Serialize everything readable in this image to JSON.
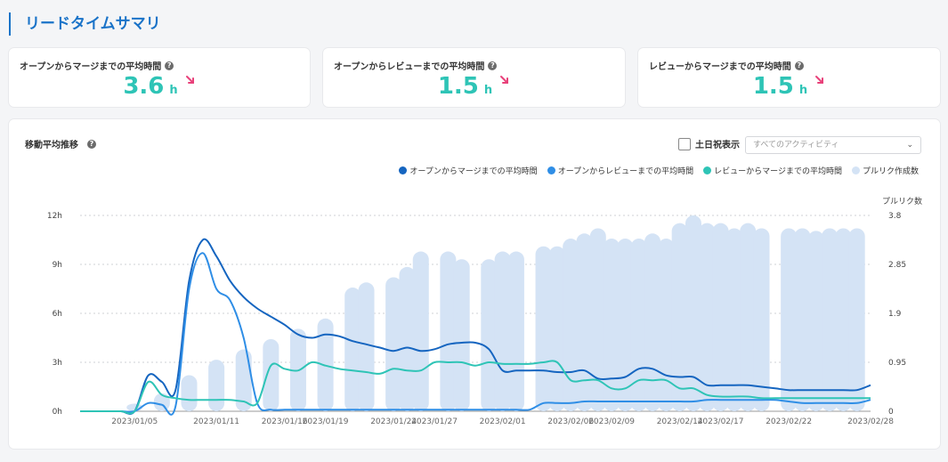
{
  "header": {
    "title": "リードタイムサマリ"
  },
  "stats": [
    {
      "label": "オープンからマージまでの平均時間",
      "value": "3.6",
      "unit": "h",
      "trend": "down"
    },
    {
      "label": "オープンからレビューまでの平均時間",
      "value": "1.5",
      "unit": "h",
      "trend": "down"
    },
    {
      "label": "レビューからマージまでの平均時間",
      "value": "1.5",
      "unit": "h",
      "trend": "down"
    }
  ],
  "help_glyph": "?",
  "chart_panel": {
    "title": "移動平均推移",
    "holiday_label": "土日祝表示",
    "holiday_checked": false,
    "activity_placeholder": "すべてのアクティビティ",
    "chevron": "⌄"
  },
  "colors": {
    "accent": "#1a73c8",
    "value": "#2ec4b6",
    "trend_down": "#e8417a",
    "series_open_merge": "#1565c0",
    "series_open_review": "#2f8ee6",
    "series_review_merge": "#2ec4b6",
    "series_pr_count": "#d4e3f5"
  },
  "chart_data": {
    "type": "bar+line",
    "x": [
      "2023/01/01",
      "2023/01/02",
      "2023/01/03",
      "2023/01/04",
      "2023/01/05",
      "2023/01/06",
      "2023/01/07",
      "2023/01/08",
      "2023/01/09",
      "2023/01/10",
      "2023/01/11",
      "2023/01/12",
      "2023/01/13",
      "2023/01/14",
      "2023/01/15",
      "2023/01/16",
      "2023/01/17",
      "2023/01/18",
      "2023/01/19",
      "2023/01/20",
      "2023/01/21",
      "2023/01/22",
      "2023/01/23",
      "2023/01/24",
      "2023/01/25",
      "2023/01/26",
      "2023/01/27",
      "2023/01/28",
      "2023/01/29",
      "2023/01/30",
      "2023/01/31",
      "2023/02/01",
      "2023/02/02",
      "2023/02/03",
      "2023/02/04",
      "2023/02/05",
      "2023/02/06",
      "2023/02/07",
      "2023/02/08",
      "2023/02/09",
      "2023/02/10",
      "2023/02/11",
      "2023/02/12",
      "2023/02/13",
      "2023/02/14",
      "2023/02/15",
      "2023/02/16",
      "2023/02/17",
      "2023/02/18",
      "2023/02/19",
      "2023/02/20",
      "2023/02/21",
      "2023/02/22",
      "2023/02/23",
      "2023/02/24",
      "2023/02/25",
      "2023/02/26",
      "2023/02/27",
      "2023/02/28"
    ],
    "x_ticks": [
      "2023/01/05",
      "2023/01/11",
      "2023/01/16",
      "2023/01/19",
      "2023/01/24",
      "2023/01/27",
      "2023/02/01",
      "2023/02/06",
      "2023/02/09",
      "2023/02/14",
      "2023/02/17",
      "2023/02/22",
      "2023/02/28"
    ],
    "y_left": {
      "ticks": [
        "0h",
        "3h",
        "6h",
        "9h",
        "12h"
      ],
      "range": [
        0,
        12
      ]
    },
    "y_right": {
      "label": "プルリク数",
      "ticks": [
        "0",
        "0.95",
        "1.9",
        "2.85",
        "3.8"
      ],
      "range": [
        0,
        3.8
      ]
    },
    "bar_days": [
      "2023/01/05",
      "2023/01/07",
      "2023/01/09",
      "2023/01/11",
      "2023/01/13",
      "2023/01/15",
      "2023/01/17",
      "2023/01/19",
      "2023/01/21",
      "2023/01/22",
      "2023/01/24",
      "2023/01/25",
      "2023/01/26",
      "2023/01/28",
      "2023/01/29",
      "2023/01/31",
      "2023/02/01",
      "2023/02/02",
      "2023/02/04",
      "2023/02/05",
      "2023/02/06",
      "2023/02/07",
      "2023/02/08",
      "2023/02/09",
      "2023/02/10",
      "2023/02/11",
      "2023/02/12",
      "2023/02/13",
      "2023/02/14",
      "2023/02/15",
      "2023/02/16",
      "2023/02/17",
      "2023/02/18",
      "2023/02/19",
      "2023/02/20",
      "2023/02/22",
      "2023/02/23",
      "2023/02/24",
      "2023/02/25",
      "2023/02/26",
      "2023/02/27"
    ],
    "bars": {
      "name": "プルリク作成数",
      "values": [
        0.15,
        0.35,
        0.7,
        1.0,
        1.2,
        1.4,
        1.6,
        1.8,
        2.4,
        2.5,
        2.6,
        2.8,
        3.1,
        3.1,
        2.95,
        2.95,
        3.1,
        3.1,
        3.2,
        3.2,
        3.35,
        3.45,
        3.55,
        3.35,
        3.35,
        3.35,
        3.45,
        3.35,
        3.65,
        3.8,
        3.65,
        3.65,
        3.55,
        3.65,
        3.55,
        3.55,
        3.55,
        3.5,
        3.55,
        3.55,
        3.55
      ]
    },
    "series": [
      {
        "name": "オープンからマージまでの平均時間",
        "values": [
          0,
          0,
          0,
          0,
          0,
          2.2,
          1.8,
          1.3,
          8.0,
          10.5,
          9.5,
          8.0,
          7.0,
          6.3,
          5.8,
          5.3,
          4.7,
          4.5,
          4.7,
          4.6,
          4.3,
          4.1,
          3.9,
          3.7,
          3.9,
          3.7,
          3.8,
          4.1,
          4.2,
          4.2,
          3.8,
          2.5,
          2.5,
          2.5,
          2.5,
          2.4,
          2.4,
          2.5,
          2.0,
          2.0,
          2.1,
          2.6,
          2.6,
          2.2,
          2.1,
          2.1,
          1.6,
          1.6,
          1.6,
          1.6,
          1.5,
          1.4,
          1.3,
          1.3,
          1.3,
          1.3,
          1.3,
          1.3,
          1.6
        ]
      },
      {
        "name": "オープンからレビューまでの平均時間",
        "values": [
          0,
          0,
          0,
          0,
          0,
          0.5,
          0.4,
          0.3,
          7.5,
          9.7,
          7.5,
          6.8,
          4.5,
          0.5,
          0.1,
          0.1,
          0.1,
          0.1,
          0.1,
          0.1,
          0.1,
          0.1,
          0.1,
          0.1,
          0.1,
          0.1,
          0.1,
          0.1,
          0.1,
          0.1,
          0.1,
          0.1,
          0.1,
          0.1,
          0.5,
          0.5,
          0.5,
          0.6,
          0.6,
          0.6,
          0.6,
          0.6,
          0.6,
          0.6,
          0.6,
          0.6,
          0.7,
          0.7,
          0.7,
          0.7,
          0.7,
          0.7,
          0.6,
          0.5,
          0.5,
          0.5,
          0.5,
          0.5,
          0.7
        ]
      },
      {
        "name": "レビューからマージまでの平均時間",
        "values": [
          0,
          0,
          0,
          0,
          0,
          1.8,
          1.0,
          0.8,
          0.7,
          0.7,
          0.7,
          0.7,
          0.6,
          0.5,
          2.8,
          2.6,
          2.5,
          3.0,
          2.8,
          2.6,
          2.5,
          2.4,
          2.3,
          2.6,
          2.5,
          2.5,
          3.0,
          3.0,
          3.0,
          2.8,
          3.0,
          2.9,
          2.9,
          2.9,
          3.0,
          3.0,
          1.9,
          1.9,
          1.9,
          1.4,
          1.4,
          1.9,
          1.9,
          1.9,
          1.4,
          1.4,
          1.0,
          0.9,
          0.9,
          0.9,
          0.8,
          0.8,
          0.8,
          0.8,
          0.8,
          0.8,
          0.8,
          0.8,
          0.8
        ]
      }
    ],
    "grid": true,
    "legend_position": "top-right"
  }
}
